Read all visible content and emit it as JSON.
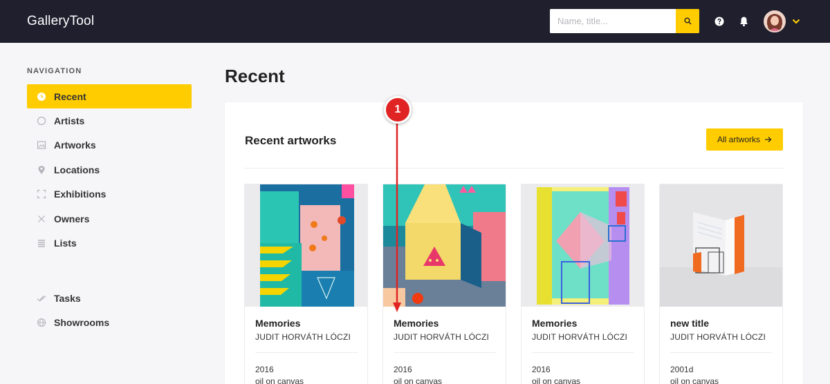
{
  "app": {
    "logo": "GalleryTool"
  },
  "search": {
    "placeholder": "Name, title..."
  },
  "colors": {
    "accent": "#ffcc00",
    "topbar": "#1f1f2e",
    "annotation": "#e02424"
  },
  "sidebar": {
    "heading": "NAVIGATION",
    "items": [
      {
        "label": "Recent",
        "icon": "clock-icon",
        "active": true
      },
      {
        "label": "Artists",
        "icon": "circle-icon"
      },
      {
        "label": "Artworks",
        "icon": "image-icon"
      },
      {
        "label": "Locations",
        "icon": "pin-icon"
      },
      {
        "label": "Exhibitions",
        "icon": "frame-icon"
      },
      {
        "label": "Owners",
        "icon": "x-icon"
      },
      {
        "label": "Lists",
        "icon": "list-icon"
      },
      {
        "label": "Tasks",
        "icon": "check-icon"
      },
      {
        "label": "Showrooms",
        "icon": "globe-icon"
      }
    ]
  },
  "main": {
    "title": "Recent",
    "panel_title": "Recent artworks",
    "all_button": "All artworks",
    "cards": [
      {
        "title": "Memories",
        "artist": "JUDIT HORVÁTH LÓCZI",
        "year": "2016",
        "medium": "oil on canvas"
      },
      {
        "title": "Memories",
        "artist": "JUDIT HORVÁTH LÓCZI",
        "year": "2016",
        "medium": "oil on canvas"
      },
      {
        "title": "Memories",
        "artist": "JUDIT HORVÁTH LÓCZI",
        "year": "2016",
        "medium": "oil on canvas"
      },
      {
        "title": "new title",
        "artist": "JUDIT HORVÁTH LÓCZI",
        "year": "2001d",
        "medium": "oil on canvas"
      }
    ]
  },
  "annotation": {
    "label": "1"
  }
}
